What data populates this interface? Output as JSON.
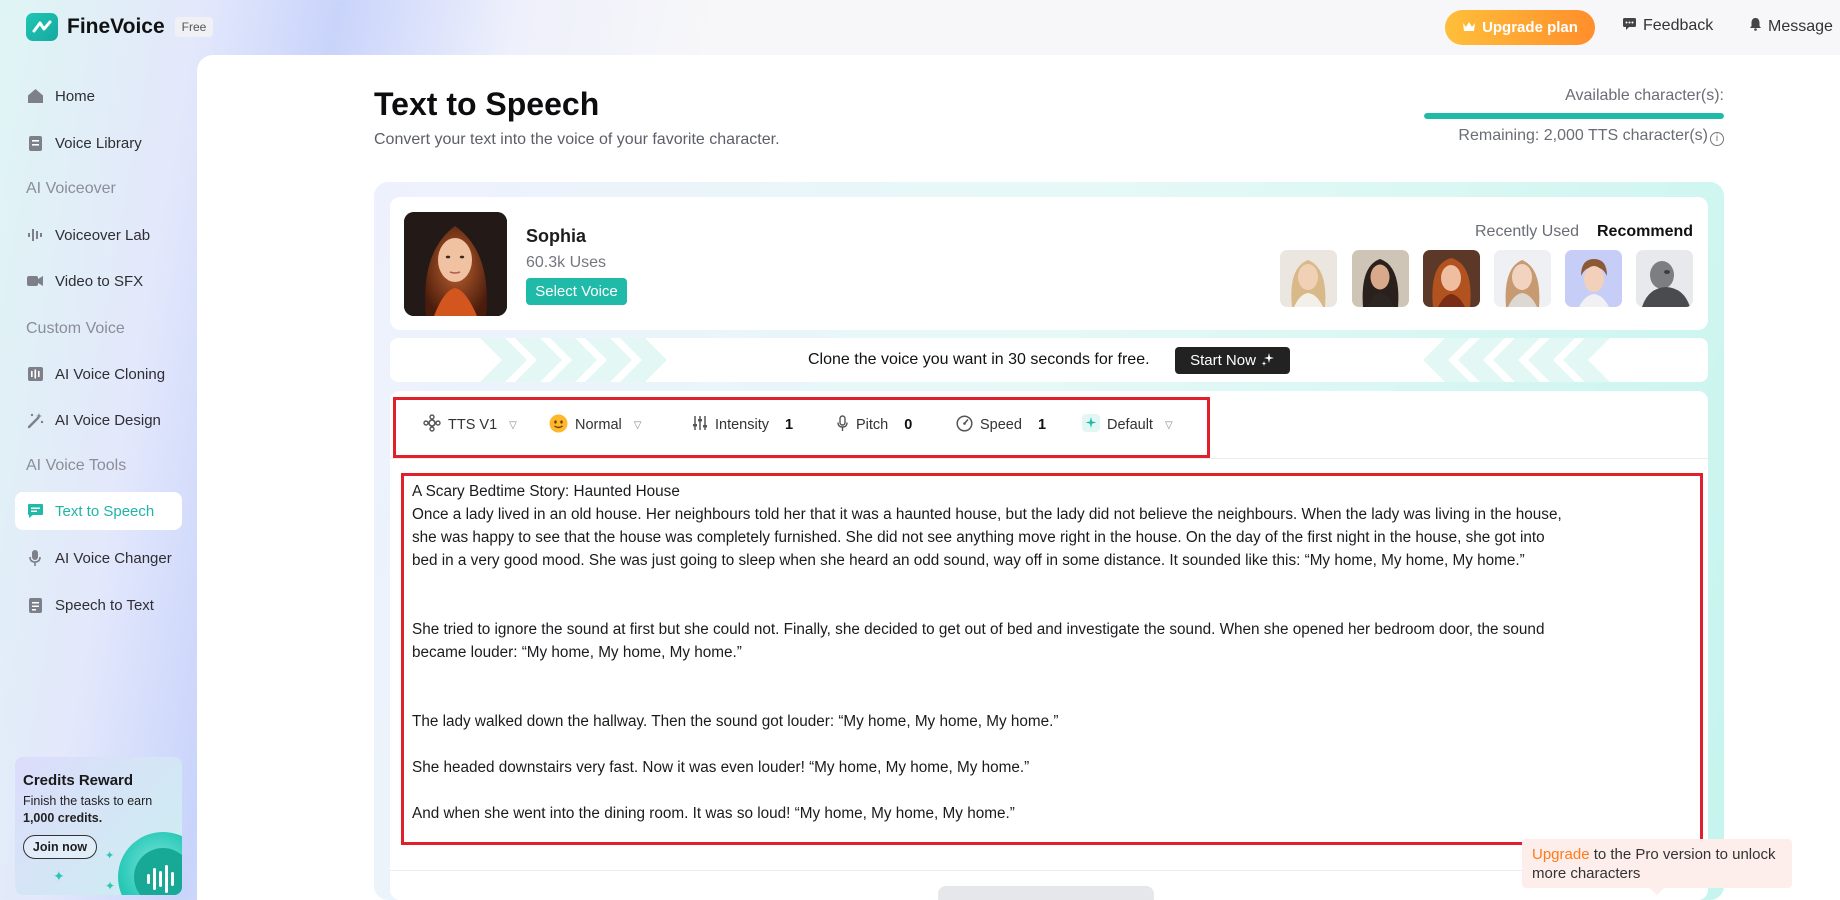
{
  "app": {
    "name": "FineVoice",
    "plan_badge": "Free"
  },
  "topbar": {
    "upgrade_label": "Upgrade plan",
    "feedback_label": "Feedback",
    "message_label": "Message"
  },
  "sidebar": {
    "items": [
      {
        "label": "Home",
        "icon": "home-icon"
      },
      {
        "label": "Voice Library",
        "icon": "library-icon"
      }
    ],
    "sections": [
      {
        "title": "AI Voiceover",
        "items": [
          {
            "label": "Voiceover Lab",
            "icon": "waveform-icon"
          },
          {
            "label": "Video to SFX",
            "icon": "video-icon"
          }
        ]
      },
      {
        "title": "Custom Voice",
        "items": [
          {
            "label": "AI Voice Cloning",
            "icon": "clone-icon"
          },
          {
            "label": "AI Voice Design",
            "icon": "magic-wand-icon"
          }
        ]
      },
      {
        "title": "AI Voice Tools",
        "items": [
          {
            "label": "Text to Speech",
            "icon": "chat-icon",
            "active": true
          },
          {
            "label": "AI Voice Changer",
            "icon": "microphone-icon"
          },
          {
            "label": "Speech to Text",
            "icon": "document-icon"
          }
        ]
      }
    ],
    "credits": {
      "title": "Credits Reward",
      "desc_prefix": "Finish the tasks to earn ",
      "desc_bold": "1,000 credits.",
      "join_label": "Join now"
    }
  },
  "page": {
    "title": "Text to Speech",
    "subtitle": "Convert your text into the voice of your favorite character.",
    "available_label": "Available character(s):",
    "available_fraction": 1.0,
    "remaining_label": "Remaining: 2,000 TTS character(s)",
    "accent_color": "#1fbba8"
  },
  "voice": {
    "name": "Sophia",
    "uses": "60.3k Uses",
    "select_label": "Select Voice",
    "tabs": {
      "recent": "Recently Used",
      "recommend": "Recommend"
    }
  },
  "clone_banner": {
    "text": "Clone the voice you want in 30 seconds for free.",
    "button": "Start Now"
  },
  "toolbar": {
    "model": "TTS V1",
    "emotion": "Normal",
    "intensity_label": "Intensity",
    "intensity_value": "1",
    "pitch_label": "Pitch",
    "pitch_value": "0",
    "speed_label": "Speed",
    "speed_value": "1",
    "style": "Default"
  },
  "editor": {
    "lines": [
      "A Scary Bedtime Story: Haunted House",
      "Once a lady lived in an old house. Her neighbours told her that it was a haunted house, but the lady did not believe the neighbours.  When the lady was living in the house,",
      "she was happy to see that the house was completely furnished. She did not see anything move right in the house. On the day of the first night in the house, she got into",
      "bed in a very good mood. She was just going to sleep when she heard an odd sound, way off in some distance. It sounded like this: “My home, My home, My home.”",
      "",
      "",
      "She tried to ignore the sound at first but she could not. Finally, she decided to get out of bed and investigate the sound.  When she opened her bedroom door, the sound",
      "became louder: “My home, My home, My home.”",
      "",
      "",
      "The lady walked down the hallway. Then the sound got louder: “My home, My home, My home.”",
      "",
      "She headed downstairs very fast. Now it was even louder! “My home, My home, My home.”",
      "",
      "And when she went into the dining room. It was so loud! “My home, My home, My home.”"
    ]
  },
  "upgrade_tip": {
    "highlight": "Upgrade",
    "rest": " to the Pro version to unlock more characters"
  }
}
